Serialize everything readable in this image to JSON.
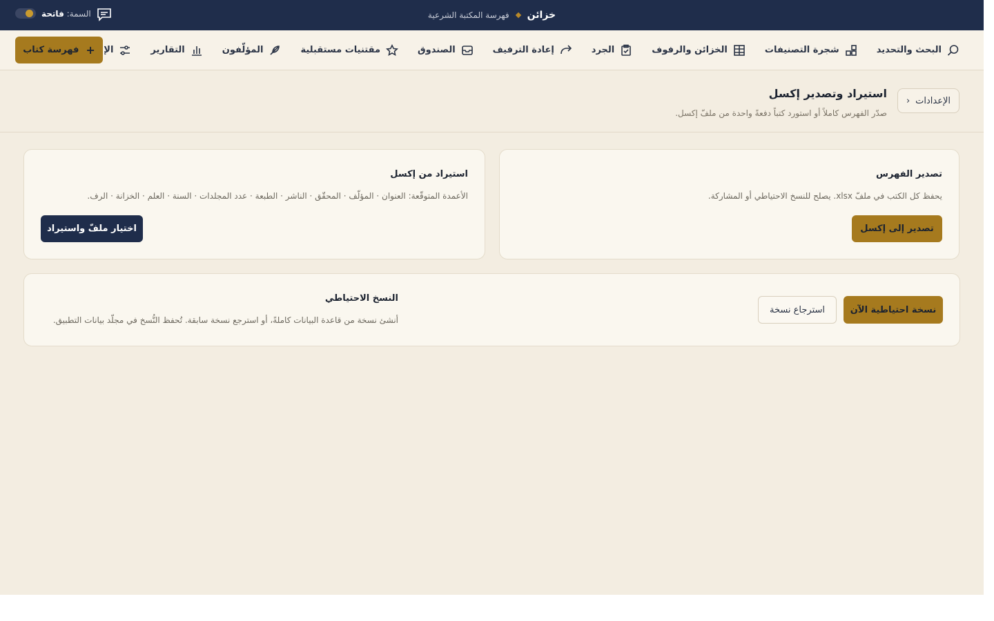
{
  "topbar": {
    "brand_name": "خزائن",
    "brand_subtitle": "فهرسة المكتبة الشرعية",
    "theme_label": "السمة:",
    "theme_value": "فاتحة"
  },
  "nav": {
    "items": [
      {
        "label": "البحث والتحديد",
        "icon": "search-icon"
      },
      {
        "label": "شجرة التصنيفات",
        "icon": "tree-icon"
      },
      {
        "label": "الخزائن والرفوف",
        "icon": "grid-icon"
      },
      {
        "label": "الجرد",
        "icon": "clipboard-icon"
      },
      {
        "label": "إعادة الترفيف",
        "icon": "redo-arrow-icon"
      },
      {
        "label": "الصندوق",
        "icon": "inbox-icon"
      },
      {
        "label": "مقتنيات مستقبلية",
        "icon": "star-icon"
      },
      {
        "label": "المؤلّفون",
        "icon": "quill-icon"
      },
      {
        "label": "التقارير",
        "icon": "bar-chart-icon"
      },
      {
        "label": "الإعدادات",
        "icon": "sliders-icon"
      }
    ],
    "add_button": "فهرسة كتاب",
    "add_icon": "+"
  },
  "page": {
    "back_label": "الإعدادات",
    "back_chevron": "‹",
    "title": "استيراد وتصدير إكسل",
    "subtitle": "صدّر الفهرس كاملاً أو استورد كتباً دفعةً واحدة من ملفّ إكسل."
  },
  "export_card": {
    "title": "تصدير الفهرس",
    "description": "يحفظ كل الكتب في ملفّ xlsx. يصلح للنسخ الاحتياطي أو المشاركة.",
    "button": "تصدير إلى إكسل"
  },
  "import_card": {
    "title": "استيراد من إكسل",
    "description": "الأعمدة المتوقّعة: العنوان · المؤلّف · المحقّق · الناشر · الطبعة · عدد المجلدات · السنة · العلم · الخزانة · الرف.",
    "button": "اختيار ملفّ واستيراد"
  },
  "backup_card": {
    "title": "النسخ الاحتياطي",
    "description": "أنشئ نسخة من قاعدة البيانات كاملةً، أو استرجع نسخة سابقة. تُحفظ النُّسخ في مجلّد بيانات التطبيق.",
    "primary_button": "نسخة احتياطية الآن",
    "secondary_button": "استرجاع نسخة"
  },
  "colors": {
    "navy": "#1f2d4b",
    "gold": "#a67a1e",
    "background": "#f3ede1",
    "card": "#faf7ef"
  }
}
